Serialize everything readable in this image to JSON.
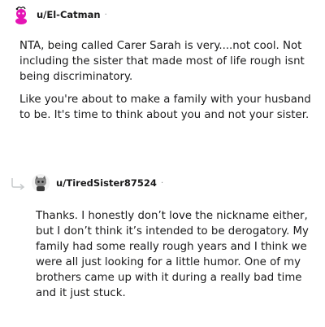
{
  "comment": {
    "username": "u/El-Catman",
    "separator": "·",
    "paragraphs": [
      "NTA, being called Carer Sarah is very....not cool. Not including the sister that made most of life rough isnt being discriminatory.",
      "Like you're about to make a family with your husband to be. It's time to think about you and not your sister."
    ]
  },
  "reply": {
    "username": "u/TiredSister87524",
    "separator": "·",
    "paragraphs": [
      "Thanks. I honestly don’t love the nickname either, but I don’t think it’s intended to be derogatory. My family had some really rough years and I think we were all just looking for a little humor. One of my brothers came up with it during a really bad time and it just stuck."
    ]
  },
  "colors": {
    "text": "#1a1a1b",
    "meta": "#878a8c",
    "avatar_pink": "#e514b4",
    "reply_line": "#c7cacc"
  }
}
